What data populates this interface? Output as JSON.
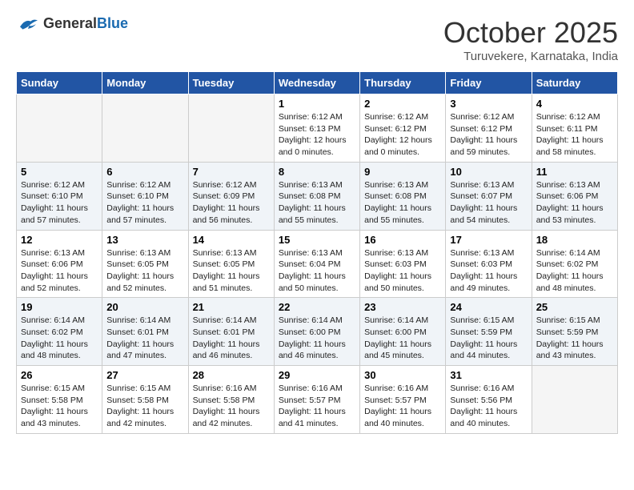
{
  "header": {
    "logo_general": "General",
    "logo_blue": "Blue",
    "month_title": "October 2025",
    "subtitle": "Turuvekere, Karnataka, India"
  },
  "days_of_week": [
    "Sunday",
    "Monday",
    "Tuesday",
    "Wednesday",
    "Thursday",
    "Friday",
    "Saturday"
  ],
  "weeks": [
    [
      {
        "day": "",
        "info": ""
      },
      {
        "day": "",
        "info": ""
      },
      {
        "day": "",
        "info": ""
      },
      {
        "day": "1",
        "info": "Sunrise: 6:12 AM\nSunset: 6:13 PM\nDaylight: 12 hours\nand 0 minutes."
      },
      {
        "day": "2",
        "info": "Sunrise: 6:12 AM\nSunset: 6:12 PM\nDaylight: 12 hours\nand 0 minutes."
      },
      {
        "day": "3",
        "info": "Sunrise: 6:12 AM\nSunset: 6:12 PM\nDaylight: 11 hours\nand 59 minutes."
      },
      {
        "day": "4",
        "info": "Sunrise: 6:12 AM\nSunset: 6:11 PM\nDaylight: 11 hours\nand 58 minutes."
      }
    ],
    [
      {
        "day": "5",
        "info": "Sunrise: 6:12 AM\nSunset: 6:10 PM\nDaylight: 11 hours\nand 57 minutes."
      },
      {
        "day": "6",
        "info": "Sunrise: 6:12 AM\nSunset: 6:10 PM\nDaylight: 11 hours\nand 57 minutes."
      },
      {
        "day": "7",
        "info": "Sunrise: 6:12 AM\nSunset: 6:09 PM\nDaylight: 11 hours\nand 56 minutes."
      },
      {
        "day": "8",
        "info": "Sunrise: 6:13 AM\nSunset: 6:08 PM\nDaylight: 11 hours\nand 55 minutes."
      },
      {
        "day": "9",
        "info": "Sunrise: 6:13 AM\nSunset: 6:08 PM\nDaylight: 11 hours\nand 55 minutes."
      },
      {
        "day": "10",
        "info": "Sunrise: 6:13 AM\nSunset: 6:07 PM\nDaylight: 11 hours\nand 54 minutes."
      },
      {
        "day": "11",
        "info": "Sunrise: 6:13 AM\nSunset: 6:06 PM\nDaylight: 11 hours\nand 53 minutes."
      }
    ],
    [
      {
        "day": "12",
        "info": "Sunrise: 6:13 AM\nSunset: 6:06 PM\nDaylight: 11 hours\nand 52 minutes."
      },
      {
        "day": "13",
        "info": "Sunrise: 6:13 AM\nSunset: 6:05 PM\nDaylight: 11 hours\nand 52 minutes."
      },
      {
        "day": "14",
        "info": "Sunrise: 6:13 AM\nSunset: 6:05 PM\nDaylight: 11 hours\nand 51 minutes."
      },
      {
        "day": "15",
        "info": "Sunrise: 6:13 AM\nSunset: 6:04 PM\nDaylight: 11 hours\nand 50 minutes."
      },
      {
        "day": "16",
        "info": "Sunrise: 6:13 AM\nSunset: 6:03 PM\nDaylight: 11 hours\nand 50 minutes."
      },
      {
        "day": "17",
        "info": "Sunrise: 6:13 AM\nSunset: 6:03 PM\nDaylight: 11 hours\nand 49 minutes."
      },
      {
        "day": "18",
        "info": "Sunrise: 6:14 AM\nSunset: 6:02 PM\nDaylight: 11 hours\nand 48 minutes."
      }
    ],
    [
      {
        "day": "19",
        "info": "Sunrise: 6:14 AM\nSunset: 6:02 PM\nDaylight: 11 hours\nand 48 minutes."
      },
      {
        "day": "20",
        "info": "Sunrise: 6:14 AM\nSunset: 6:01 PM\nDaylight: 11 hours\nand 47 minutes."
      },
      {
        "day": "21",
        "info": "Sunrise: 6:14 AM\nSunset: 6:01 PM\nDaylight: 11 hours\nand 46 minutes."
      },
      {
        "day": "22",
        "info": "Sunrise: 6:14 AM\nSunset: 6:00 PM\nDaylight: 11 hours\nand 46 minutes."
      },
      {
        "day": "23",
        "info": "Sunrise: 6:14 AM\nSunset: 6:00 PM\nDaylight: 11 hours\nand 45 minutes."
      },
      {
        "day": "24",
        "info": "Sunrise: 6:15 AM\nSunset: 5:59 PM\nDaylight: 11 hours\nand 44 minutes."
      },
      {
        "day": "25",
        "info": "Sunrise: 6:15 AM\nSunset: 5:59 PM\nDaylight: 11 hours\nand 43 minutes."
      }
    ],
    [
      {
        "day": "26",
        "info": "Sunrise: 6:15 AM\nSunset: 5:58 PM\nDaylight: 11 hours\nand 43 minutes."
      },
      {
        "day": "27",
        "info": "Sunrise: 6:15 AM\nSunset: 5:58 PM\nDaylight: 11 hours\nand 42 minutes."
      },
      {
        "day": "28",
        "info": "Sunrise: 6:16 AM\nSunset: 5:58 PM\nDaylight: 11 hours\nand 42 minutes."
      },
      {
        "day": "29",
        "info": "Sunrise: 6:16 AM\nSunset: 5:57 PM\nDaylight: 11 hours\nand 41 minutes."
      },
      {
        "day": "30",
        "info": "Sunrise: 6:16 AM\nSunset: 5:57 PM\nDaylight: 11 hours\nand 40 minutes."
      },
      {
        "day": "31",
        "info": "Sunrise: 6:16 AM\nSunset: 5:56 PM\nDaylight: 11 hours\nand 40 minutes."
      },
      {
        "day": "",
        "info": ""
      }
    ]
  ]
}
